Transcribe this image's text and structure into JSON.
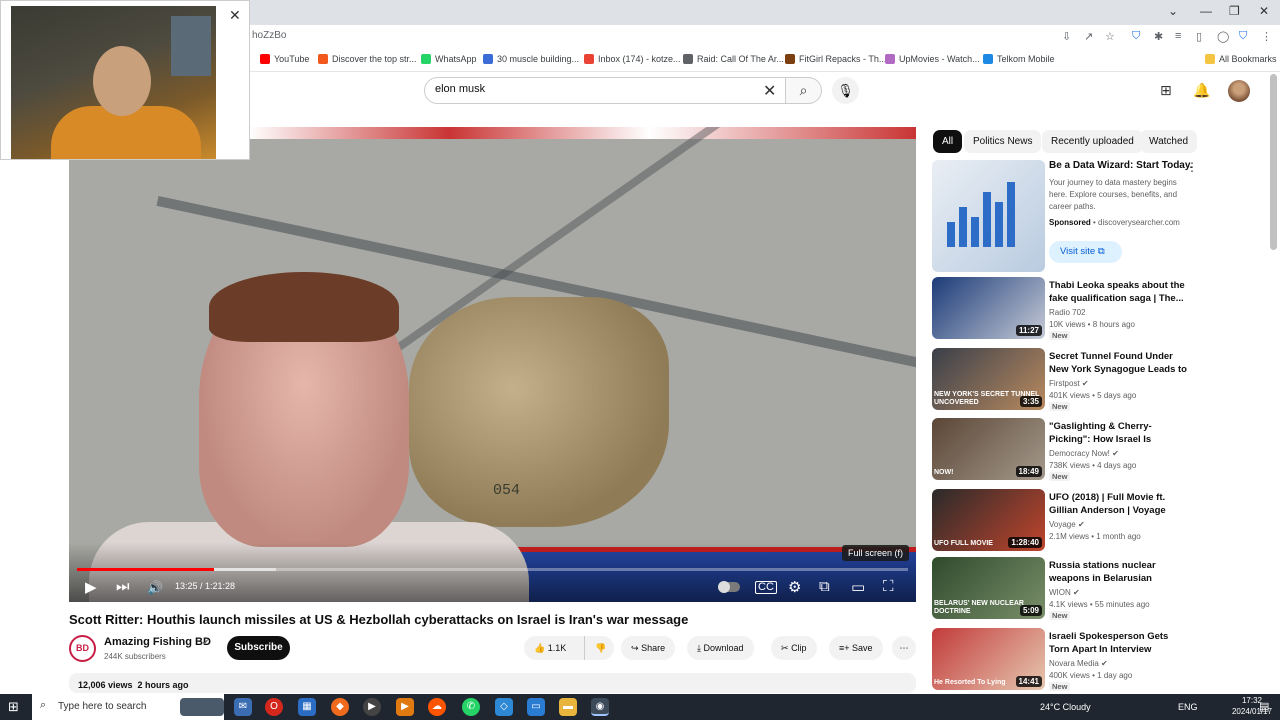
{
  "browser": {
    "tab_partial": "hoZzBo",
    "bookmarks": [
      {
        "label": "YouTube",
        "color": "#ff0000"
      },
      {
        "label": "Discover the top str...",
        "color": "#f2581c"
      },
      {
        "label": "WhatsApp",
        "color": "#25d366"
      },
      {
        "label": "30 muscle building...",
        "color": "#3b6bd6"
      },
      {
        "label": "Inbox (174) - kotze...",
        "color": "#ea4335"
      },
      {
        "label": "Raid: Call Of The Ar...",
        "color": "#5f6368"
      },
      {
        "label": "FitGirl Repacks - Th...",
        "color": "#7b3f12"
      },
      {
        "label": "UpMovies - Watch...",
        "color": "#b06ac2"
      },
      {
        "label": "Telkom Mobile",
        "color": "#1e88e5"
      }
    ],
    "all_bookmarks": "All Bookmarks"
  },
  "search": {
    "value": "elon musk",
    "placeholder": "Search"
  },
  "player": {
    "current_time": "13:25",
    "duration": "1:21:28",
    "time_display": "13:25 / 1:21:28",
    "played_fraction": 0.165,
    "loaded_fraction": 0.24,
    "fullscreen_tooltip": "Full screen (f)",
    "overlay_number": "054"
  },
  "video": {
    "title": "Scott Ritter: Houthis launch missiles at US & Hezbollah cyberattacks on Israel is Iran's war message",
    "channel": "Amazing Fishing BD",
    "channel_initials": "BD",
    "subscribers": "244K subscribers",
    "subscribe_label": "Subscribe",
    "likes": "1.1K",
    "share_label": "Share",
    "download_label": "Download",
    "clip_label": "Clip",
    "save_label": "Save",
    "views_line": "12,006 views  2 hours ago"
  },
  "chips": [
    "All",
    "Politics News",
    "Recently uploaded",
    "Watched"
  ],
  "ad": {
    "title": "Be a Data Wizard: Start Today.",
    "description": "Your journey to data mastery begins here. Explore courses, benefits, and career paths.",
    "sponsored": "Sponsored",
    "domain": "discoverysearcher.com",
    "cta": "Visit site"
  },
  "recommendations": [
    {
      "title": "Thabi Leoka speaks about the fake qualification saga | The...",
      "channel": "Radio 702",
      "verified": false,
      "meta": "10K views • 8 hours ago",
      "duration": "11:27",
      "badge": "New",
      "overlay": "",
      "colors": [
        "#1b3b78",
        "#c6cad6"
      ]
    },
    {
      "title": "Secret Tunnel Found Under New York Synagogue Leads to Bra...",
      "channel": "Firstpost",
      "verified": true,
      "meta": "401K views • 5 days ago",
      "duration": "3:35",
      "badge": "New",
      "overlay": "NEW YORK'S SECRET TUNNEL UNCOVERED",
      "colors": [
        "#3a3f4a",
        "#b98a5f"
      ]
    },
    {
      "title": "\"Gaslighting & Cherry-Picking\": How Israel Is Defending Itself ...",
      "channel": "Democracy Now!",
      "verified": true,
      "meta": "738K views • 4 days ago",
      "duration": "18:49",
      "badge": "New",
      "overlay": "NOW!",
      "colors": [
        "#5b4636",
        "#a49a8c"
      ]
    },
    {
      "title": "UFO (2018) | Full Movie ft. Gillian Anderson | Voyage",
      "channel": "Voyage",
      "verified": true,
      "meta": "2.1M views • 1 month ago",
      "duration": "1:28:40",
      "badge": "",
      "overlay": "UFO FULL MOVIE",
      "colors": [
        "#2a2a2a",
        "#c1452d"
      ]
    },
    {
      "title": "Russia stations nuclear weapons in Belarusian territor...",
      "channel": "WION",
      "verified": true,
      "meta": "4.1K views • 55 minutes ago",
      "duration": "5:09",
      "badge": "New",
      "overlay": "BELARUS' NEW NUCLEAR DOCTRINE",
      "colors": [
        "#2f4a2c",
        "#7a8f6a"
      ]
    },
    {
      "title": "Israeli Spokesperson Gets Torn Apart In Interview",
      "channel": "Novara Media",
      "verified": true,
      "meta": "400K views • 1 day ago",
      "duration": "14:41",
      "badge": "New",
      "overlay": "He Resorted To Lying",
      "colors": [
        "#c23b3b",
        "#e6c8b0"
      ]
    }
  ],
  "taskbar": {
    "search_placeholder": "Type here to search",
    "weather": "24°C  Cloudy",
    "language": "ENG",
    "time": "17:32",
    "date": "2024/01/17"
  }
}
